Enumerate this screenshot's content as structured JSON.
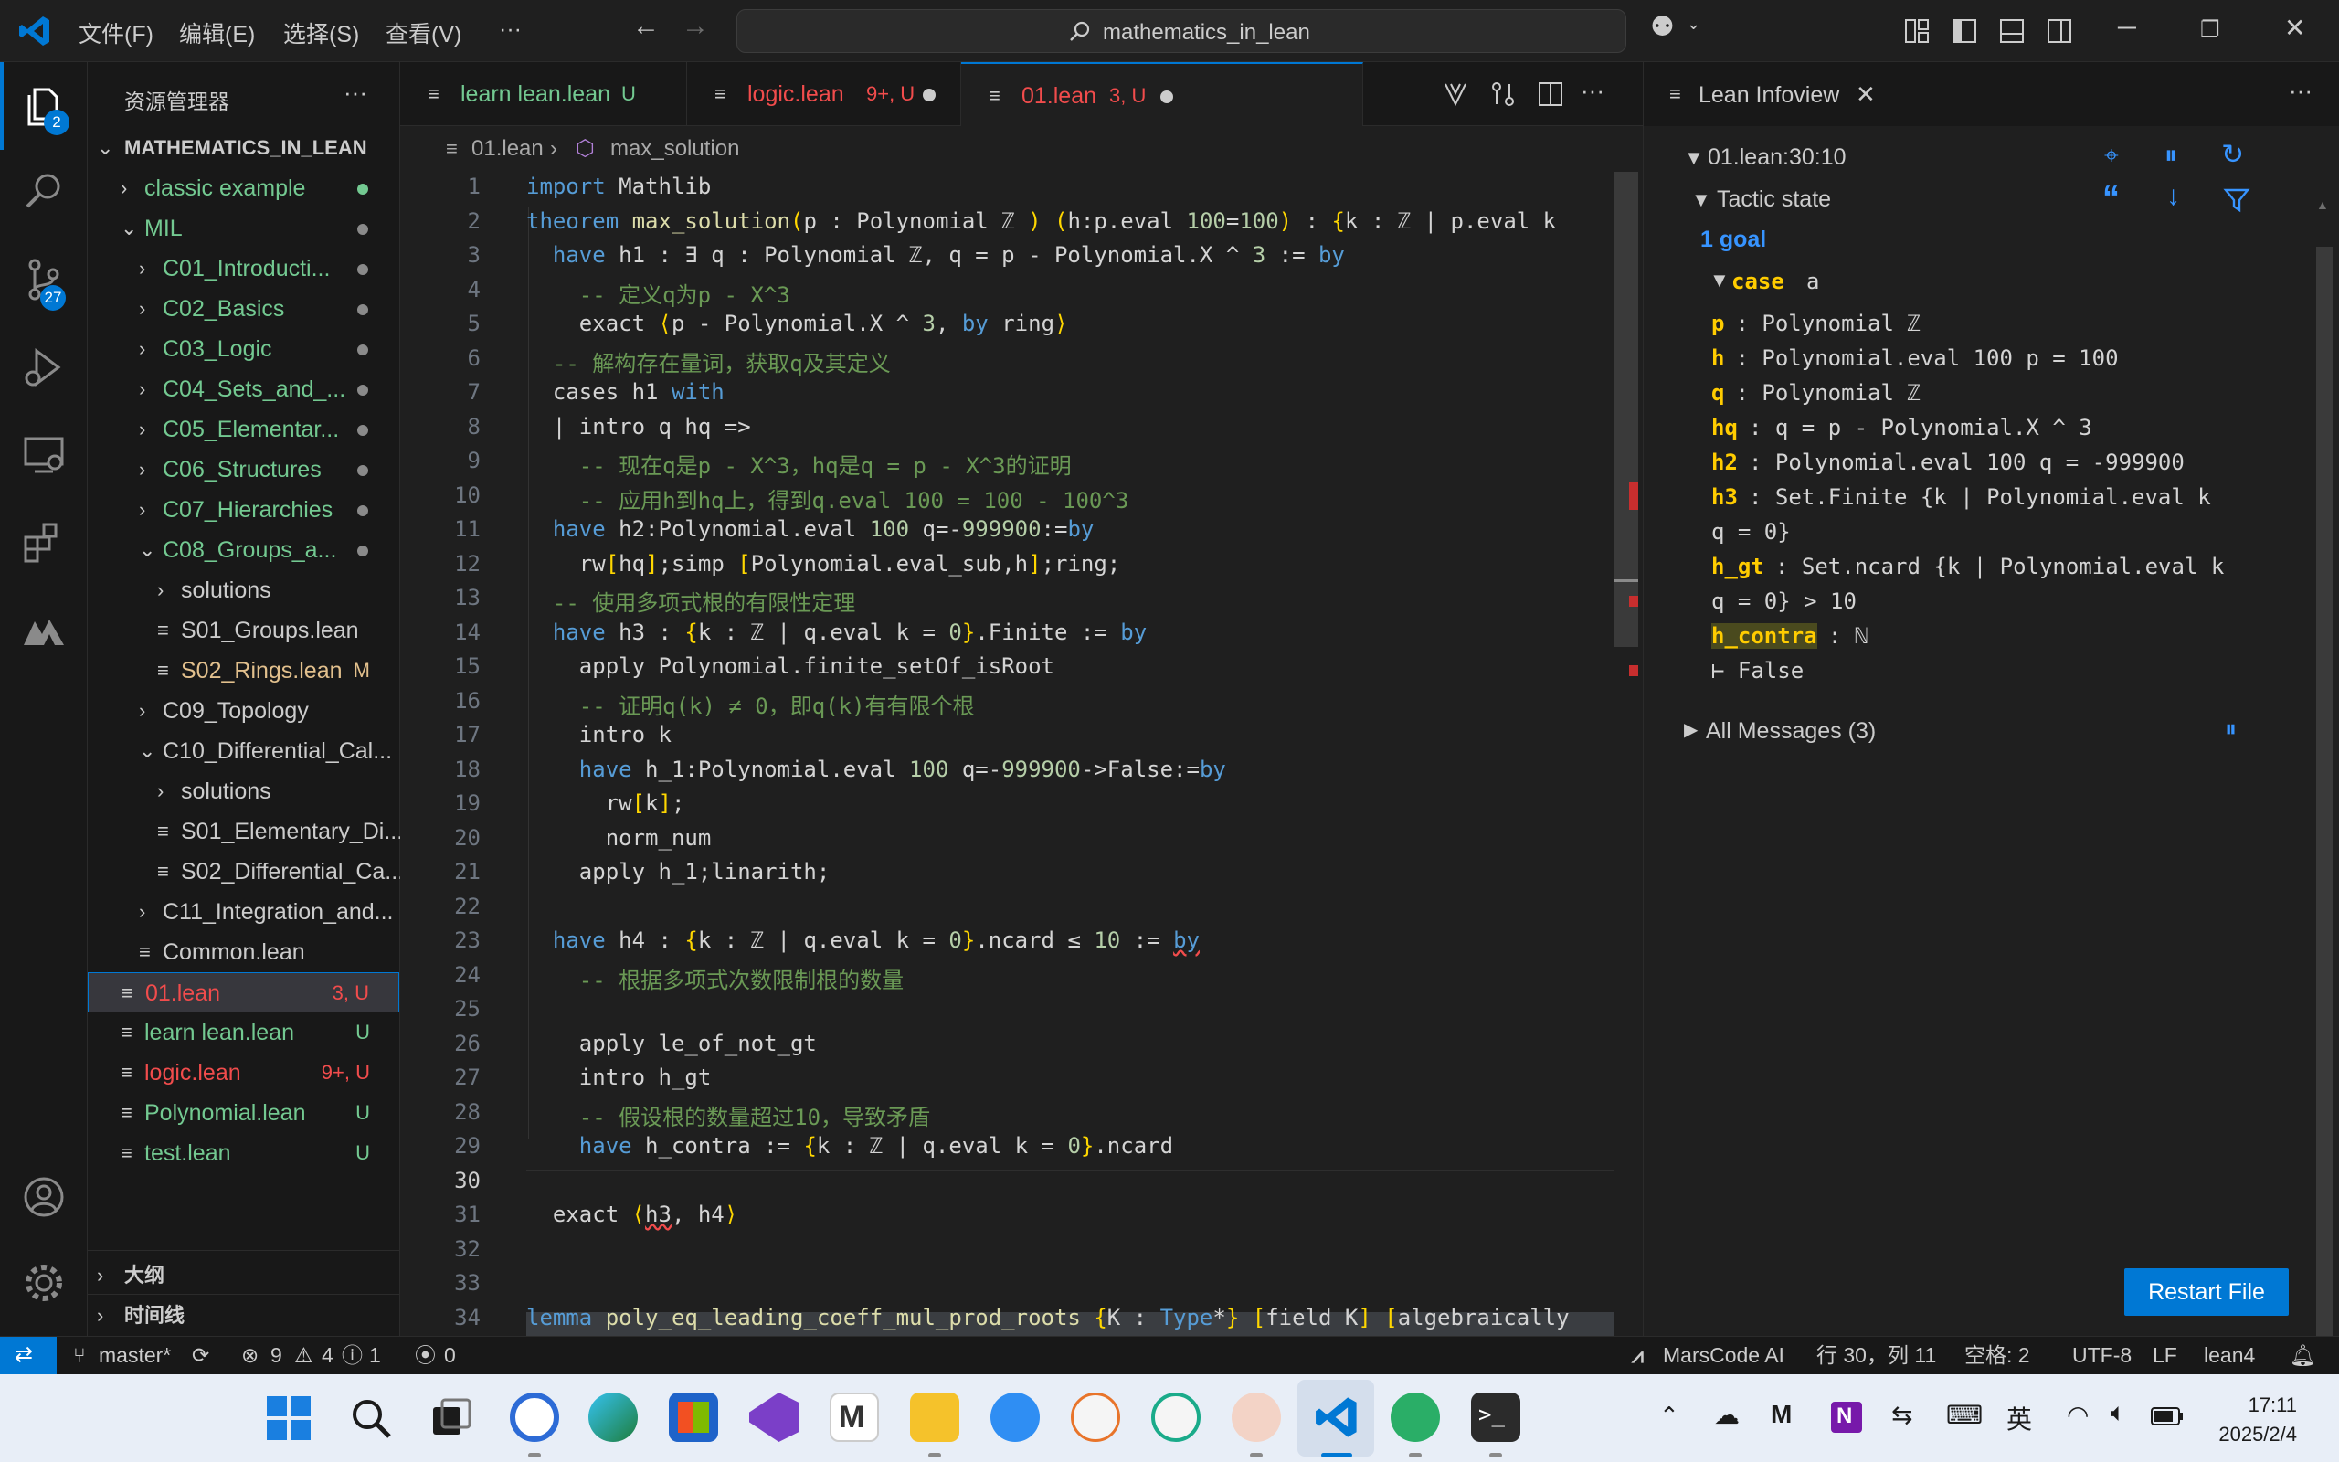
{
  "titlebar": {
    "menus": [
      "文件(F)",
      "编辑(E)",
      "选择(S)",
      "查看(V)",
      "···"
    ],
    "search": "mathematics_in_lean"
  },
  "activity": {
    "explorer_badge": "2",
    "scm_badge": "27"
  },
  "sidebar": {
    "title": "资源管理器",
    "more": "···",
    "root": "MATHEMATICS_IN_LEAN",
    "items": [
      {
        "label": "classic example",
        "type": "folder",
        "open": false,
        "depth": 1,
        "color": "#73c991",
        "dot": "#73c991"
      },
      {
        "label": "MIL",
        "type": "folder",
        "open": true,
        "depth": 1,
        "color": "#73c991",
        "dot": "#8a8a8a"
      },
      {
        "label": "C01_Introducti...",
        "type": "folder",
        "open": false,
        "depth": 2,
        "color": "#73c991",
        "dot": "#8a8a8a"
      },
      {
        "label": "C02_Basics",
        "type": "folder",
        "open": false,
        "depth": 2,
        "color": "#73c991",
        "dot": "#8a8a8a"
      },
      {
        "label": "C03_Logic",
        "type": "folder",
        "open": false,
        "depth": 2,
        "color": "#73c991",
        "dot": "#8a8a8a"
      },
      {
        "label": "C04_Sets_and_...",
        "type": "folder",
        "open": false,
        "depth": 2,
        "color": "#73c991",
        "dot": "#8a8a8a"
      },
      {
        "label": "C05_Elementar...",
        "type": "folder",
        "open": false,
        "depth": 2,
        "color": "#73c991",
        "dot": "#8a8a8a"
      },
      {
        "label": "C06_Structures",
        "type": "folder",
        "open": false,
        "depth": 2,
        "color": "#73c991",
        "dot": "#8a8a8a"
      },
      {
        "label": "C07_Hierarchies",
        "type": "folder",
        "open": false,
        "depth": 2,
        "color": "#73c991",
        "dot": "#8a8a8a"
      },
      {
        "label": "C08_Groups_a...",
        "type": "folder",
        "open": true,
        "depth": 2,
        "color": "#73c991",
        "dot": "#8a8a8a"
      },
      {
        "label": "solutions",
        "type": "folder",
        "open": false,
        "depth": 3,
        "color": "#cccccc",
        "dot": ""
      },
      {
        "label": "S01_Groups.lean",
        "type": "file",
        "depth": 3,
        "color": "#cccccc",
        "status": ""
      },
      {
        "label": "S02_Rings.lean",
        "type": "file",
        "depth": 3,
        "color": "#e2c08d",
        "status": "M"
      },
      {
        "label": "C09_Topology",
        "type": "folder",
        "open": false,
        "depth": 2,
        "color": "#cccccc",
        "dot": ""
      },
      {
        "label": "C10_Differential_Cal...",
        "type": "folder",
        "open": true,
        "depth": 2,
        "color": "#cccccc",
        "dot": ""
      },
      {
        "label": "solutions",
        "type": "folder",
        "open": false,
        "depth": 3,
        "color": "#cccccc",
        "dot": ""
      },
      {
        "label": "S01_Elementary_Di...",
        "type": "file",
        "depth": 3,
        "color": "#cccccc",
        "status": ""
      },
      {
        "label": "S02_Differential_Ca...",
        "type": "file",
        "depth": 3,
        "color": "#cccccc",
        "status": ""
      },
      {
        "label": "C11_Integration_and...",
        "type": "folder",
        "open": false,
        "depth": 2,
        "color": "#cccccc",
        "dot": ""
      },
      {
        "label": "Common.lean",
        "type": "file",
        "depth": 2,
        "color": "#cccccc",
        "status": ""
      },
      {
        "label": "01.lean",
        "type": "file",
        "depth": 1,
        "color": "#f14c4c",
        "status": "3, U",
        "selected": true
      },
      {
        "label": "learn lean.lean",
        "type": "file",
        "depth": 1,
        "color": "#73c991",
        "status": "U"
      },
      {
        "label": "logic.lean",
        "type": "file",
        "depth": 1,
        "color": "#f14c4c",
        "status": "9+, U"
      },
      {
        "label": "Polynomial.lean",
        "type": "file",
        "depth": 1,
        "color": "#73c991",
        "status": "U"
      },
      {
        "label": "test.lean",
        "type": "file",
        "depth": 1,
        "color": "#73c991",
        "status": "U"
      }
    ],
    "outline": "大纲",
    "timeline": "时间线"
  },
  "tabs": [
    {
      "label": "learn lean.lean",
      "status": "U",
      "color": "#73c991",
      "active": false,
      "dirty": false
    },
    {
      "label": "logic.lean",
      "status": "9+, U",
      "color": "#f14c4c",
      "active": false,
      "dirty": true
    },
    {
      "label": "01.lean",
      "status": "3, U",
      "color": "#f14c4c",
      "active": true,
      "dirty": true
    }
  ],
  "breadcrumb": {
    "file": "01.lean",
    "symbol": "max_solution"
  },
  "editor": {
    "current_line": 30,
    "lines": [
      "<span class='kw'>import</span> Mathlib",
      "<span class='kw'>theorem</span> <span class='fn'>max_solution</span><span class='br'>(</span>p : Polynomial ℤ <span class='br'>)</span> <span class='br'>(</span>h:p.eval <span class='nm'>100</span>=<span class='nm'>100</span><span class='br'>)</span> : <span class='br'>{</span>k : ℤ | p.eval k",
      "  <span class='kw'>have</span> h1 : ∃ q : Polynomial ℤ, q = p - Polynomial.X ^ <span class='nm'>3</span> := <span class='kw'>by</span>",
      "    <span class='cm'>-- 定义q为p - X^3</span>",
      "    exact <span class='br'>⟨</span>p - Polynomial.X ^ <span class='nm'>3</span>, <span class='kw'>by</span> ring<span class='br'>⟩</span>",
      "  <span class='cm'>-- 解构存在量词，获取q及其定义</span>",
      "  cases h1 <span class='kw'>with</span>",
      "  | intro q hq =>",
      "    <span class='cm'>-- 现在q是p - X^3，hq是q = p - X^3的证明</span>",
      "    <span class='cm'>-- 应用h到hq上，得到q.eval 100 = 100 - 100^3</span>",
      "  <span class='kw'>have</span> h2:Polynomial.eval <span class='nm'>100</span> q=-<span class='nm'>999900</span>:=<span class='kw'>by</span>",
      "    rw<span class='br'>[</span>hq<span class='br'>]</span>;simp <span class='br'>[</span>Polynomial.eval_sub,h<span class='br'>]</span>;ring;",
      "  <span class='cm'>-- 使用多项式根的有限性定理</span>",
      "  <span class='kw'>have</span> h3 : <span class='br'>{</span>k : ℤ | q.eval k = <span class='nm'>0</span><span class='br'>}</span>.Finite := <span class='kw'>by</span>",
      "    apply Polynomial.finite_setOf_isRoot",
      "    <span class='cm'>-- 证明q(k) ≠ 0，即q(k)有有限个根</span>",
      "    intro k",
      "    <span class='kw'>have</span> h_1:Polynomial.eval <span class='nm'>100</span> q=-<span class='nm'>999900</span>->False:=<span class='kw'>by</span>",
      "      rw<span class='br'>[</span>k<span class='br'>]</span>;",
      "      norm_num",
      "    apply h_1;linarith;",
      "",
      "  <span class='kw'>have</span> h4 : <span class='br'>{</span>k : ℤ | q.eval k = <span class='nm'>0</span><span class='br'>}</span>.ncard ≤ <span class='nm'>10</span> := <span class='kw sq'>by</span>",
      "    <span class='cm'>-- 根据多项式次数限制根的数量</span>",
      "",
      "    apply le_of_not_gt",
      "    intro h_gt",
      "    <span class='cm'>-- 假设根的数量超过10，导致矛盾</span>",
      "    <span class='kw'>have</span> h_contra := <span class='br'>{</span>k : ℤ | q.eval k = <span class='nm'>0</span><span class='br'>}</span>.ncard",
      "",
      "  exact <span class='br'>⟨</span><span class='sq'>h3</span>, h4<span class='br'>⟩</span>",
      "",
      "",
      "<span class='kw'>lemma</span> <span class='fn'>poly_eq_leading_coeff_mul_prod_roots</span> <span class='br'>{</span>K : <span class='kw'>Type</span>*<span class='br'>}</span> <span class='br'>[</span>field K<span class='br'>]</span> <span class='br'>[</span>algebraically"
    ]
  },
  "infoview": {
    "title": "Lean Infoview",
    "location": "01.lean:30:10",
    "tactic_state": "Tactic state",
    "goal_count": "1 goal",
    "case_kw": "case",
    "case_name": "a",
    "hyps": [
      {
        "name": "p",
        "type": ": Polynomial ℤ"
      },
      {
        "name": "h",
        "type": ": Polynomial.eval 100 p = 100"
      },
      {
        "name": "q",
        "type": ": Polynomial ℤ"
      },
      {
        "name": "hq",
        "type": ": q = p - Polynomial.X ^ 3"
      },
      {
        "name": "h2",
        "type": ": Polynomial.eval 100 q = -999900"
      },
      {
        "name": "h3",
        "type": ": Set.Finite {k | Polynomial.eval k",
        "cont": "q = 0}"
      },
      {
        "name": "h_gt",
        "type": ": Set.ncard {k | Polynomial.eval k",
        "cont": "q = 0} > 10"
      },
      {
        "name": "h_contra",
        "type": ": ℕ",
        "highlight": true
      }
    ],
    "goal": "⊢ False",
    "all_messages": "All Messages (3)",
    "restart": "Restart File"
  },
  "statusbar": {
    "branch": "master*",
    "errors": "9",
    "warnings": "4",
    "infos": "1",
    "ports": "0",
    "marscode": "MarsCode AI",
    "position": "行 30，列 11",
    "spaces": "空格: 2",
    "encoding": "UTF-8",
    "eol": "LF",
    "language": "lean4"
  },
  "taskbar": {
    "ime": "英",
    "time": "17:11",
    "date": "2025/2/4",
    "colors": {
      "vscode": "#0078d4",
      "onenote": "#7719aa",
      "wechat": "#2aae67"
    }
  }
}
